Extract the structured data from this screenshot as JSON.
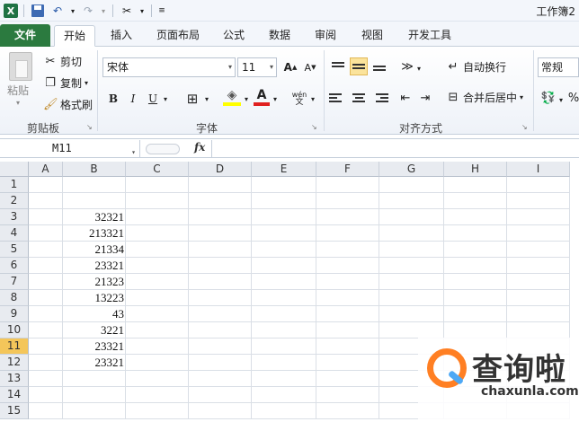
{
  "window": {
    "title": "工作簿2"
  },
  "ribbon_tabs": [
    "文件",
    "开始",
    "插入",
    "页面布局",
    "公式",
    "数据",
    "审阅",
    "视图",
    "开发工具"
  ],
  "clipboard": {
    "paste": "粘贴",
    "cut": "剪切",
    "copy": "复制",
    "format_painter": "格式刷",
    "group": "剪贴板"
  },
  "font": {
    "name": "宋体",
    "size": "11",
    "bold": "B",
    "italic": "I",
    "underline": "U",
    "group": "字体",
    "phonetic": "wén"
  },
  "alignment": {
    "wrap": "自动换行",
    "merge": "合并后居中",
    "group": "对齐方式"
  },
  "number": {
    "format": "常规"
  },
  "formula_bar": {
    "name_box": "M11",
    "fx": "fx",
    "content": ""
  },
  "columns": [
    "A",
    "B",
    "C",
    "D",
    "E",
    "F",
    "G",
    "H",
    "I"
  ],
  "rows": [
    "1",
    "2",
    "3",
    "4",
    "5",
    "6",
    "7",
    "8",
    "9",
    "10",
    "11",
    "12",
    "13",
    "14",
    "15"
  ],
  "active_row": "11",
  "cells_b": [
    "",
    "",
    "32321",
    "213321",
    "21334",
    "23321",
    "21323",
    "13223",
    "43",
    "3221",
    "23321",
    "23321",
    "",
    "",
    ""
  ],
  "watermark": {
    "name": "查询啦",
    "url": "chaxunla.com"
  },
  "colors": {
    "file_tab": "#2b7a3f",
    "active_row_header": "#f4c65a",
    "watermark_orange": "#ff7f23"
  }
}
